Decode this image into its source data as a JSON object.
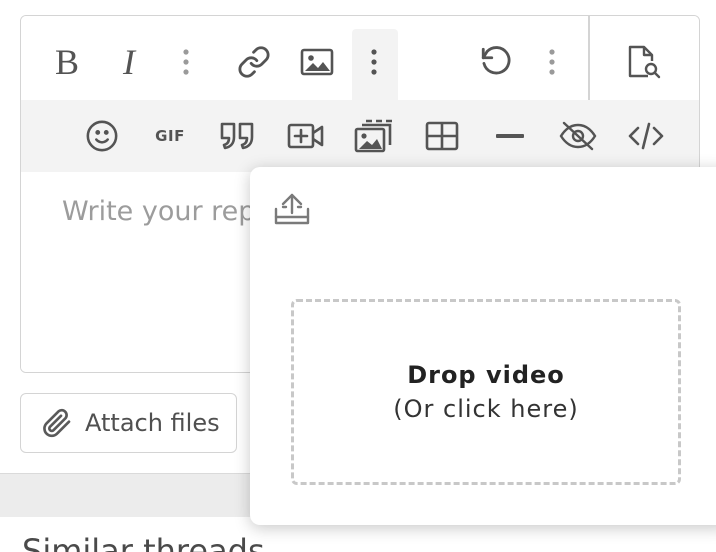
{
  "toolbar": {
    "bold_label": "B",
    "italic_label": "I",
    "gif_label": "GIF",
    "row1_buttons": [
      "bold",
      "italic",
      "more-text-options",
      "link",
      "image",
      "more-insert-options",
      "undo",
      "more-options",
      "preview"
    ],
    "row2_buttons": [
      "emoji",
      "gif",
      "quote",
      "insert-video",
      "media-gallery",
      "table",
      "horizontal-line",
      "spoiler",
      "code"
    ]
  },
  "editor": {
    "placeholder": "Write your rep"
  },
  "attach": {
    "label": "Attach files"
  },
  "video_popup": {
    "drop_title": "Drop video",
    "drop_subtitle": "(Or click here)"
  },
  "section": {
    "title": "Similar threads"
  }
}
